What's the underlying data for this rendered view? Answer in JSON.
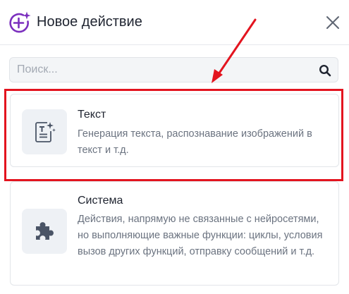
{
  "header": {
    "title": "Новое действие",
    "icon": "plus-sparkle-icon",
    "close_icon": "close-icon"
  },
  "search": {
    "placeholder": "Поиск...",
    "value": "",
    "icon": "search-icon"
  },
  "cards": [
    {
      "title": "Текст",
      "description": "Генерация текста, распознавание изображений в текст и т.д.",
      "icon": "text-sparkle-icon"
    },
    {
      "title": "Система",
      "description": "Действия, напрямую не связанные с нейросетями, но выполняющие важные функции: циклы, условия вызов других функций, отправку сообщений и т.д.",
      "icon": "puzzle-icon"
    }
  ],
  "colors": {
    "accent": "#7b2fbe",
    "highlight": "#e3141f",
    "icon_fill": "#4a5466",
    "icon_bg": "#eef1f5"
  }
}
